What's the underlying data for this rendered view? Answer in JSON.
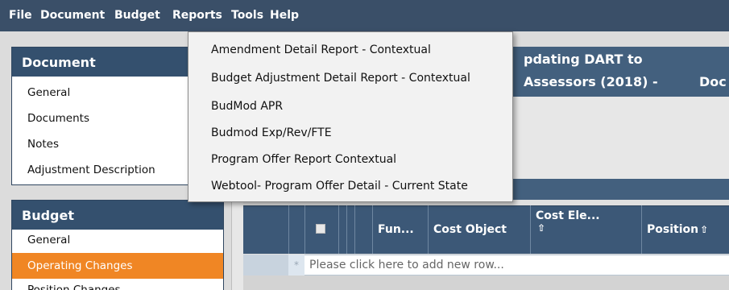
{
  "menubar": {
    "items": [
      "File",
      "Document",
      "Budget",
      "Reports",
      "Tools",
      "Help"
    ]
  },
  "reports_menu": {
    "items": [
      "Amendment Detail Report - Contextual",
      "Budget Adjustment Detail Report - Contextual",
      "BudMod APR",
      "Budmod Exp/Rev/FTE",
      "Program Offer Report Contextual",
      "Webtool- Program Offer Detail - Current State"
    ]
  },
  "sidebar": {
    "document": {
      "title": "Document",
      "items": [
        "General",
        "Documents",
        "Notes",
        "Adjustment Description"
      ]
    },
    "budget": {
      "title": "Budget",
      "items": [
        "General",
        "Operating Changes",
        "Position Changes"
      ],
      "active": "Operating Changes"
    }
  },
  "document_header": {
    "title_line1": "pdating DART to",
    "title_line2": "Assessors (2018) -",
    "right_fragment": "Doc"
  },
  "grid": {
    "columns": [
      "Fun...",
      "Cost Object",
      "Cost Ele...",
      "Position"
    ],
    "sort_icon": "⇧",
    "new_row_star": "*",
    "new_row_placeholder": "Please click here to add new row..."
  },
  "colors": {
    "menubar": "#3a4f68",
    "panel_header": "#34506e",
    "active_item": "#f08624",
    "grid_header": "#3c5877"
  }
}
